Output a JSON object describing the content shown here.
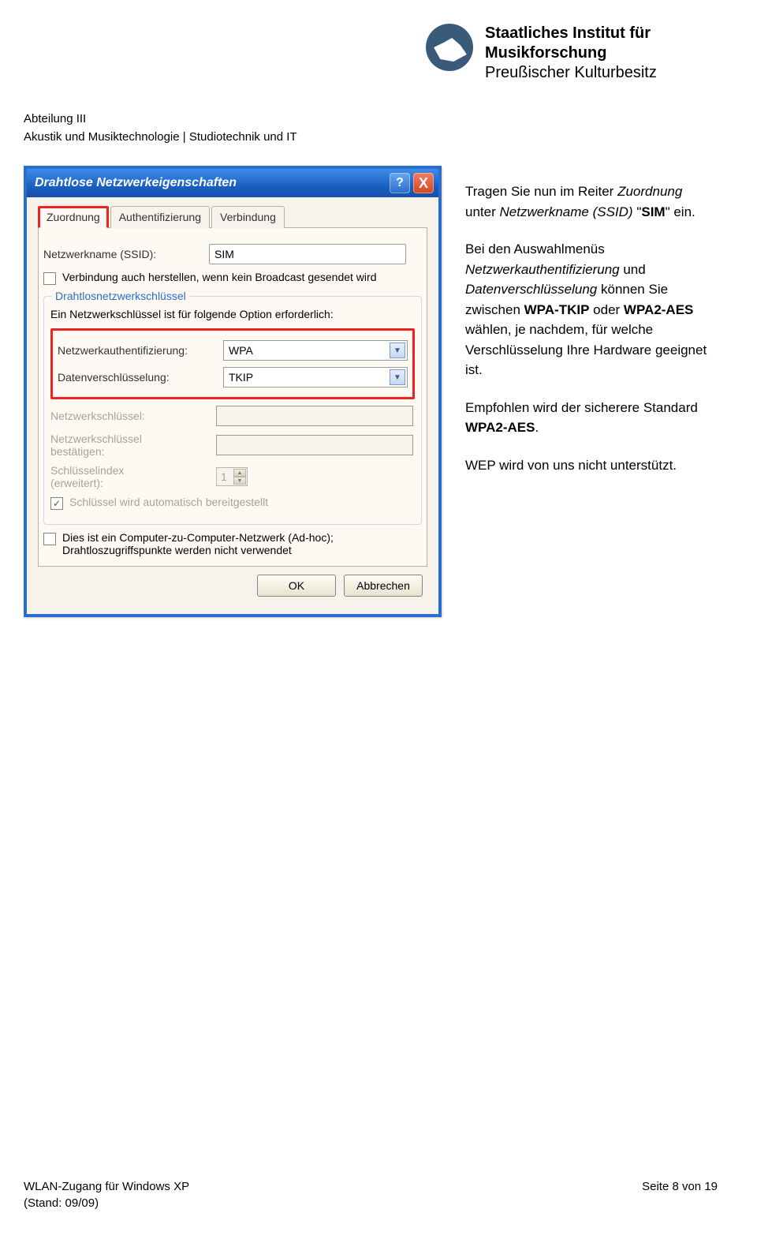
{
  "header": {
    "dept_line1": "Abteilung III",
    "dept_line2": "Akustik und Musiktechnologie | Studiotechnik und IT",
    "org_line1": "Staatliches Institut für",
    "org_line2": "Musikforschung",
    "org_line3": "Preußischer Kulturbesitz"
  },
  "dialog": {
    "title": "Drahtlose Netzwerkeigenschaften",
    "help_glyph": "?",
    "close_glyph": "X",
    "tabs": {
      "t1": "Zuordnung",
      "t2": "Authentifizierung",
      "t3": "Verbindung"
    },
    "ssid_label": "Netzwerkname (SSID):",
    "ssid_value": "SIM",
    "chk_broadcast": "Verbindung auch herstellen, wenn kein Broadcast gesendet wird",
    "legend": "Drahtlosnetzwerkschlüssel",
    "keyreq": "Ein Netzwerkschlüssel ist für folgende Option erforderlich:",
    "auth_label": "Netzwerkauthentifizierung:",
    "auth_value": "WPA",
    "enc_label": "Datenverschlüsselung:",
    "enc_value": "TKIP",
    "key_label": "Netzwerkschlüssel:",
    "key2_label1": "Netzwerkschlüssel",
    "key2_label2": "bestätigen:",
    "idx_label1": "Schlüsselindex",
    "idx_label2": "(erweitert):",
    "idx_value": "1",
    "chk_auto": "Schlüssel wird automatisch bereitgestellt",
    "chk_adhoc1": "Dies ist ein Computer-zu-Computer-Netzwerk (Ad-hoc);",
    "chk_adhoc2": "Drahtloszugriffspunkte werden nicht verwendet",
    "btn_ok": "OK",
    "btn_cancel": "Abbrechen"
  },
  "instructions": {
    "p1a": "Tragen Sie nun im Reiter ",
    "p1b": "Zuordnung",
    "p1c": " unter ",
    "p1d": "Netzwerkname (SSID)",
    "p1e": " \"",
    "p1f": "SIM",
    "p1g": "\" ein.",
    "p2a": "Bei den Auswahlmenüs ",
    "p2b": "Netzwerkauthentifizierung",
    "p2c": " und ",
    "p2d": "Datenverschlüsselung",
    "p2e": " können Sie zwischen ",
    "p2f": "WPA-TKIP",
    "p2g": " oder ",
    "p2h": "WPA2-AES",
    "p2i": " wählen, je nachdem, für welche Verschlüsselung Ihre Hardware geeignet ist.",
    "p3a": "Empfohlen wird der sicherere Standard ",
    "p3b": "WPA2-AES",
    "p3c": ".",
    "p4": "WEP wird von uns nicht unterstützt."
  },
  "footer": {
    "left1": "WLAN-Zugang für Windows XP",
    "left2": "(Stand: 09/09)",
    "right": "Seite 8 von 19"
  }
}
